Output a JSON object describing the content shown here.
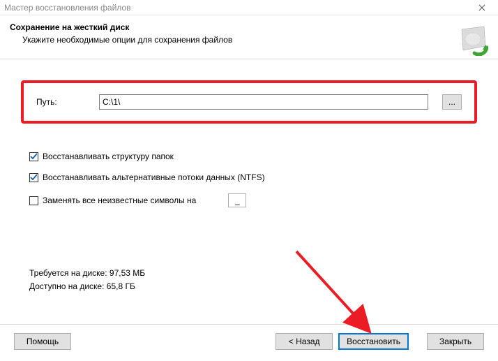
{
  "window": {
    "title": "Мастер восстановления файлов"
  },
  "header": {
    "heading": "Сохранение на жесткий диск",
    "subheading": "Укажите необходимые опции для сохранения файлов"
  },
  "path": {
    "label": "Путь:",
    "value": "C:\\1\\",
    "browse": "..."
  },
  "options": {
    "restore_folders": {
      "checked": true,
      "label": "Восстанавливать структуру папок"
    },
    "restore_ads": {
      "checked": true,
      "label": "Восстанавливать альтернативные потоки данных (NTFS)"
    },
    "replace_unknown": {
      "checked": false,
      "label": "Заменять все неизвестные символы на",
      "value": "_"
    }
  },
  "stats": {
    "required_label": "Требуется на диске:",
    "required_value": "97,53 МБ",
    "available_label": "Доступно на диске:",
    "available_value": "65,8 ГБ"
  },
  "footer": {
    "help": "Помощь",
    "back": "< Назад",
    "recover": "Восстановить",
    "close": "Закрыть"
  }
}
